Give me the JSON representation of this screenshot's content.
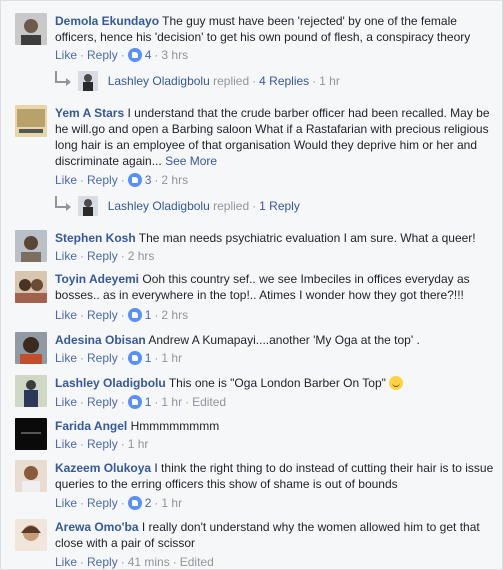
{
  "comments": [
    {
      "name": "Demola Ekundayo",
      "text": "The guy must have been 'rejected' by one of the female officers, hence his 'decision' to get his own pound of flesh, a conspiracy theory",
      "like": "Like",
      "reply": "Reply",
      "count": "4",
      "time": "3 hrs"
    },
    {
      "name": "Yem A Stars",
      "text": "I understand that the crude barber officer had been recalled. May be he will.go and open a Barbing saloon What if a Rastafarian with precious religious long hair is an employee of that organisation Would they deprive him or her and discriminate again...",
      "see_more": "See More",
      "like": "Like",
      "reply": "Reply",
      "count": "3",
      "time": "2 hrs"
    },
    {
      "name": "Stephen Kosh",
      "text": "The man needs psychiatric evaluation I am sure. What a queer!",
      "like": "Like",
      "reply": "Reply",
      "time": "2 hrs"
    },
    {
      "name": "Toyin Adeyemi",
      "text": "Ooh this country sef.. we see Imbeciles in offices everyday as bosses.. as in everywhere in the top!.. Atimes I wonder how they got there?!!!",
      "like": "Like",
      "reply": "Reply",
      "count": "1",
      "time": "2 hrs"
    },
    {
      "name": "Adesina Obisan",
      "text": "Andrew A Kumapayi....another 'My Oga at the top' .",
      "like": "Like",
      "reply": "Reply",
      "count": "1",
      "time": "1 hr"
    },
    {
      "name": "Lashley Oladigbolu",
      "text": "This one is \"Oga London Barber On Top\"",
      "like": "Like",
      "reply": "Reply",
      "count": "1",
      "time": "1 hr",
      "edited": "Edited"
    },
    {
      "name": "Farida Angel",
      "text": "Hmmmmmmmm",
      "like": "Like",
      "reply": "Reply",
      "time": "1 hr"
    },
    {
      "name": "Kazeem Olukoya",
      "text": "I think the right thing to do instead of cutting their hair is to issue queries to the erring officers this show of shame is out of bounds",
      "like": "Like",
      "reply": "Reply",
      "count": "2",
      "time": "1 hr"
    },
    {
      "name": "Arewa Omo'ba",
      "text": "I really don't understand why the women allowed him to get that close with a pair of scissor",
      "like": "Like",
      "reply": "Reply",
      "time": "41 mins",
      "edited": "Edited"
    }
  ],
  "replies": [
    {
      "name": "Lashley Oladigbolu",
      "action": "replied",
      "count": "4 Replies",
      "time": "1 hr"
    },
    {
      "name": "Lashley Oladigbolu",
      "action": "replied",
      "count": "1 Reply"
    }
  ],
  "colors": {
    "link": "#365899",
    "muted": "#90949c",
    "reaction": "#5890ff"
  }
}
